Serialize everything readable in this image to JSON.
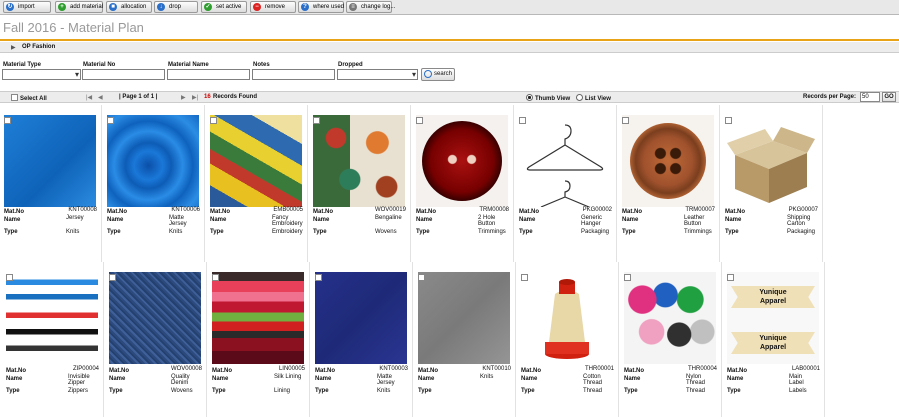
{
  "toolbar": {
    "buttons": [
      {
        "label": "import",
        "icon": "import-icon",
        "color": "#2a6fc9"
      },
      {
        "label": "add material",
        "icon": "plus-icon",
        "color": "#2e9e2e"
      },
      {
        "label": "allocation",
        "icon": "allocation-icon",
        "color": "#2a6fc9"
      },
      {
        "label": "drop",
        "icon": "drop-icon",
        "color": "#2a6fc9"
      },
      {
        "label": "set active",
        "icon": "check-icon",
        "color": "#2e9e2e"
      },
      {
        "label": "remove",
        "icon": "remove-icon",
        "color": "#d22"
      },
      {
        "label": "where used",
        "icon": "where-used-icon",
        "color": "#2a6fc9"
      },
      {
        "label": "change log...",
        "icon": "change-log-icon",
        "color": "#777"
      }
    ]
  },
  "page_title": "Fall 2016 - Material Plan",
  "org_label": "OP Fashion",
  "filters": {
    "material_type": "Material Type",
    "material_no": "Material No",
    "material_name": "Material Name",
    "notes": "Notes",
    "dropped": "Dropped",
    "search": "search"
  },
  "listbar": {
    "select_all": "Select All",
    "page": "| Page 1 of 1 |",
    "records_count": "16",
    "records_label": "Records Found",
    "thumb_view": "Thumb View",
    "list_view": "List View",
    "records_per_page": "Records per Page:",
    "per_page": "50",
    "go": "GO"
  },
  "labels": {
    "mat_no": "Mat.No",
    "name": "Name",
    "type": "Type"
  },
  "materials": [
    {
      "no": "KNT00008",
      "name": "Jersey",
      "type": "Knits"
    },
    {
      "no": "KNT00006",
      "name": "Matte\nJersey",
      "type": "Knits"
    },
    {
      "no": "EMB00005",
      "name": "Fancy\nEmbroidery",
      "type": "Embroidery"
    },
    {
      "no": "WOV00019",
      "name": "Bengaline",
      "type": "Wovens"
    },
    {
      "no": "TRM00008",
      "name": "2 Hole\nButton",
      "type": "Trimmings"
    },
    {
      "no": "PKG00002",
      "name": "Generic\nHanger",
      "type": "Packaging"
    },
    {
      "no": "TRM00007",
      "name": "Leather\nButton",
      "type": "Trimmings"
    },
    {
      "no": "PKG00007",
      "name": "Shipping\nCarton",
      "type": "Packaging"
    },
    {
      "no": "ZIP00004",
      "name": "Invisible\nZipper",
      "type": "Zippers"
    },
    {
      "no": "WOV00008",
      "name": "Quality\nDenim",
      "type": "Wovens"
    },
    {
      "no": "LIN00005",
      "name": "Silk Lining",
      "type": "Lining"
    },
    {
      "no": "KNT00003",
      "name": "Matte\nJersey",
      "type": "Knits"
    },
    {
      "no": "KNT00010",
      "name": "Knits",
      "type": ""
    },
    {
      "no": "THR00001",
      "name": "Cotton\nThread",
      "type": "Thread"
    },
    {
      "no": "THR00004",
      "name": "Nylon\nThread",
      "type": "Thread"
    },
    {
      "no": "LAB00001",
      "name": "Main\nLabel",
      "type": "Labels"
    }
  ],
  "label_print": "Yunique\nApparel"
}
